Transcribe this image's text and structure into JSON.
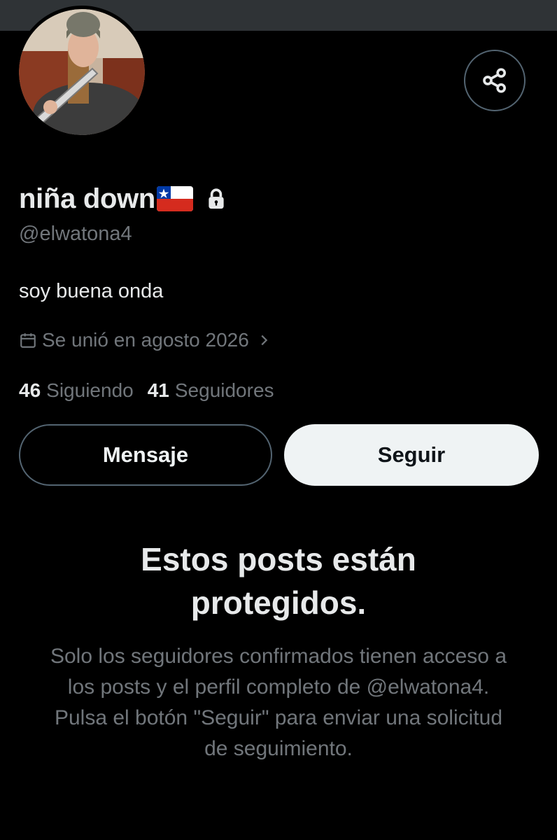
{
  "profile": {
    "display_name": "niña down",
    "handle": "@elwatona4",
    "bio": "soy buena onda",
    "joined": "Se unió en agosto 2026",
    "following_count": "46",
    "following_label": "Siguiendo",
    "followers_count": "41",
    "followers_label": "Seguidores",
    "flag_icon": "chile-flag-icon",
    "lock_icon": "lock-icon"
  },
  "actions": {
    "message_label": "Mensaje",
    "follow_label": "Seguir",
    "share_icon": "share-icon"
  },
  "protected_notice": {
    "title": "Estos posts están protegidos.",
    "body": "Solo los seguidores confirmados tienen acceso a los posts y el perfil completo de @elwatona4. Pulsa el botón \"Seguir\" para enviar una solicitud de seguimiento."
  },
  "colors": {
    "background": "#000000",
    "banner": "#2f3336",
    "primary_text": "#e7e9ea",
    "secondary_text": "#71767b",
    "border": "#536471",
    "follow_button_bg": "#eff3f4"
  }
}
